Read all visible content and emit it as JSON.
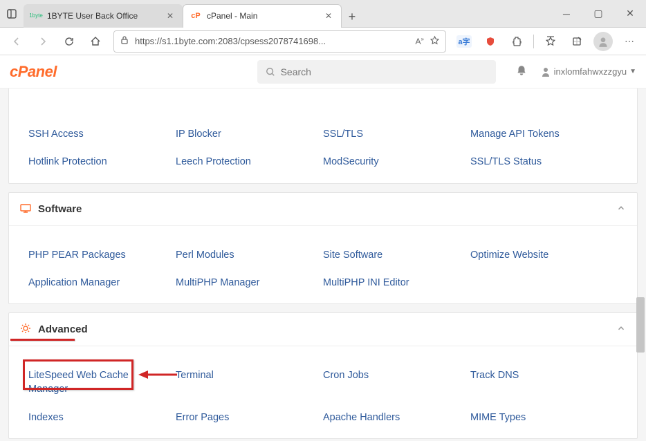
{
  "browser": {
    "tabs": [
      {
        "label": "1BYTE User Back Office",
        "active": false
      },
      {
        "label": "cPanel - Main",
        "active": true
      }
    ],
    "url": "https://s1.1byte.com:2083/cpsess2078741698..."
  },
  "cpanel": {
    "search_placeholder": "Search",
    "username": "inxlomfahwxzzgyu"
  },
  "sections": {
    "security": {
      "items": [
        "SSH Access",
        "IP Blocker",
        "SSL/TLS",
        "Manage API Tokens",
        "Hotlink Protection",
        "Leech Protection",
        "ModSecurity",
        "SSL/TLS Status"
      ]
    },
    "software": {
      "title": "Software",
      "items": [
        "PHP PEAR Packages",
        "Perl Modules",
        "Site Software",
        "Optimize Website",
        "Application Manager",
        "MultiPHP Manager",
        "MultiPHP INI Editor"
      ]
    },
    "advanced": {
      "title": "Advanced",
      "items": [
        "LiteSpeed Web Cache Manager",
        "Terminal",
        "Cron Jobs",
        "Track DNS",
        "Indexes",
        "Error Pages",
        "Apache Handlers",
        "MIME Types"
      ]
    }
  }
}
